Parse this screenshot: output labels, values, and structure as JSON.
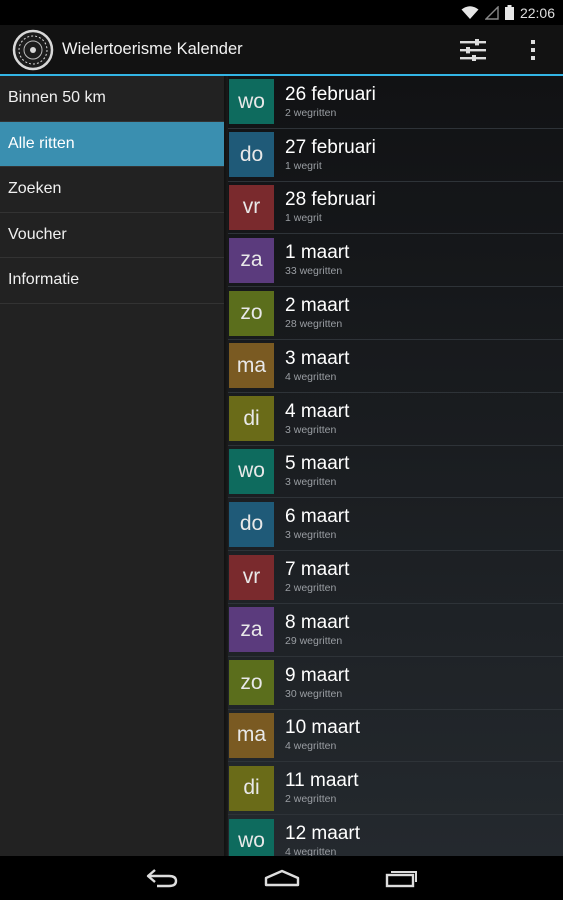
{
  "status": {
    "time": "22:06"
  },
  "app": {
    "title": "Wielertoerisme Kalender"
  },
  "drawer": {
    "items": [
      {
        "label": "Binnen 50 km",
        "active": false
      },
      {
        "label": "Alle ritten",
        "active": true
      },
      {
        "label": "Zoeken",
        "active": false
      },
      {
        "label": "Voucher",
        "active": false
      },
      {
        "label": "Informatie",
        "active": false
      }
    ]
  },
  "rows": [
    {
      "day": "wo",
      "date": "26 februari",
      "count": "2 wegritten",
      "color": "#0e6b5e"
    },
    {
      "day": "do",
      "date": "27 februari",
      "count": "1 wegrit",
      "color": "#1f5a78"
    },
    {
      "day": "vr",
      "date": "28 februari",
      "count": "1 wegrit",
      "color": "#7a2a2d"
    },
    {
      "day": "za",
      "date": "1 maart",
      "count": "33 wegritten",
      "color": "#5b3b7d"
    },
    {
      "day": "zo",
      "date": "2 maart",
      "count": "28 wegritten",
      "color": "#5b6e1c"
    },
    {
      "day": "ma",
      "date": "3 maart",
      "count": "4 wegritten",
      "color": "#7a5a22"
    },
    {
      "day": "di",
      "date": "4 maart",
      "count": "3 wegritten",
      "color": "#6a6b18"
    },
    {
      "day": "wo",
      "date": "5 maart",
      "count": "3 wegritten",
      "color": "#0e6b5e"
    },
    {
      "day": "do",
      "date": "6 maart",
      "count": "3 wegritten",
      "color": "#1f5a78"
    },
    {
      "day": "vr",
      "date": "7 maart",
      "count": "2 wegritten",
      "color": "#7a2a2d"
    },
    {
      "day": "za",
      "date": "8 maart",
      "count": "29 wegritten",
      "color": "#5b3b7d"
    },
    {
      "day": "zo",
      "date": "9 maart",
      "count": "30 wegritten",
      "color": "#5b6e1c"
    },
    {
      "day": "ma",
      "date": "10 maart",
      "count": "4 wegritten",
      "color": "#7a5a22"
    },
    {
      "day": "di",
      "date": "11 maart",
      "count": "2 wegritten",
      "color": "#6a6b18"
    },
    {
      "day": "wo",
      "date": "12 maart",
      "count": "4 wegritten",
      "color": "#0e6b5e"
    }
  ],
  "icons": {
    "wifi": "wifi-icon",
    "signal": "signal-icon",
    "battery": "battery-icon",
    "logo": "app-logo-icon",
    "filter": "filter-sliders-icon",
    "overflow": "overflow-menu-icon",
    "back": "back-icon",
    "home": "home-icon",
    "recents": "recent-apps-icon"
  }
}
